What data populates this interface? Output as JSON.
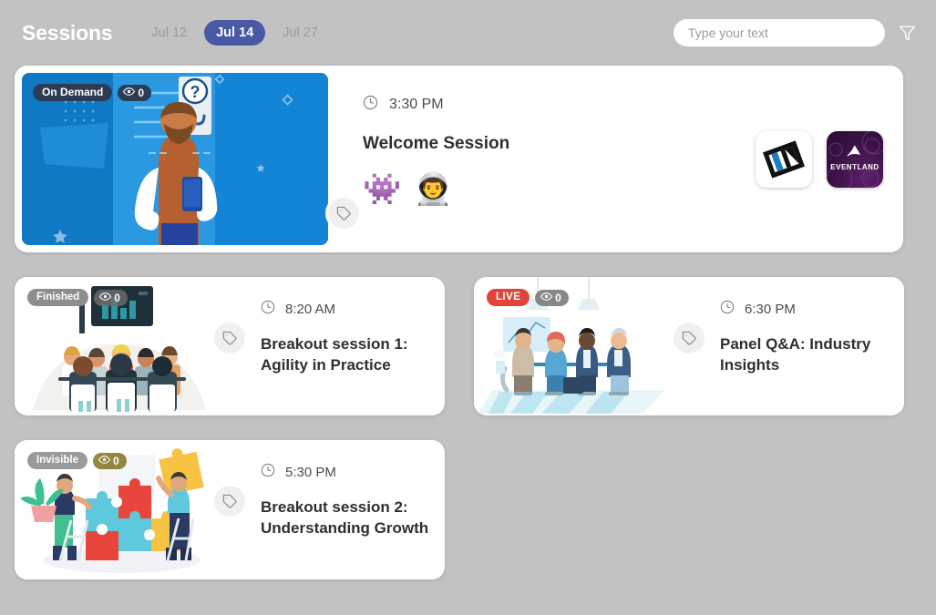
{
  "header": {
    "title": "Sessions",
    "date_tabs": [
      {
        "label": "Jul 12",
        "active": false
      },
      {
        "label": "Jul 14",
        "active": true
      },
      {
        "label": "Jul 27",
        "active": false
      }
    ],
    "search": {
      "placeholder": "Type your text",
      "value": ""
    },
    "filter_icon": "funnel-filter-icon",
    "active_tab_color": "#4a59a6",
    "title_color": "#ffffff"
  },
  "page": {
    "background_color": "#c2c2c2"
  },
  "sessions": [
    {
      "id": "welcome-session",
      "status_badge": {
        "label": "On Demand",
        "style": "ondemand",
        "color": "#2c3c55"
      },
      "views": {
        "icon": "eye-icon",
        "count": "0",
        "pill_style": "dark"
      },
      "time": "3:30 PM",
      "time_icon": "clock-icon",
      "tag_icon": "tag-icon",
      "title": "Welcome Session",
      "avatars": [
        "👾",
        "👨‍🚀"
      ],
      "thumbnail_alt": "man-with-phone-blue-illustration",
      "logos": [
        {
          "name": "sponsor-logo-abstract",
          "text": ""
        },
        {
          "name": "sponsor-logo-eventland",
          "text": "EVENTLAND"
        }
      ]
    },
    {
      "id": "breakout-session-1",
      "status_badge": {
        "label": "Finished",
        "style": "finished",
        "color": "#8d8d8d"
      },
      "views": {
        "icon": "eye-icon",
        "count": "0",
        "pill_style": "grey"
      },
      "time": "8:20 AM",
      "time_icon": "clock-icon",
      "tag_icon": "tag-icon",
      "title": "Breakout session 1: Agility in Practice",
      "thumbnail_alt": "classroom-audience-presentation-illustration"
    },
    {
      "id": "panel-qa",
      "status_badge": {
        "label": "LIVE",
        "style": "live",
        "color": "#e0443a"
      },
      "views": {
        "icon": "eye-icon",
        "count": "0",
        "pill_style": "grey"
      },
      "time": "6:30 PM",
      "time_icon": "clock-icon",
      "tag_icon": "tag-icon",
      "title": "Panel Q&A: Industry Insights",
      "thumbnail_alt": "panel-discussion-table-illustration"
    },
    {
      "id": "breakout-session-2",
      "status_badge": {
        "label": "Invisible",
        "style": "invisible",
        "color": "#9a9a9a"
      },
      "views": {
        "icon": "eye-icon",
        "count": "0",
        "pill_style": "olive"
      },
      "time": "5:30 PM",
      "time_icon": "clock-icon",
      "tag_icon": "tag-icon",
      "title": "Breakout session 2: Understanding Growth",
      "thumbnail_alt": "people-assembling-puzzle-illustration"
    }
  ]
}
